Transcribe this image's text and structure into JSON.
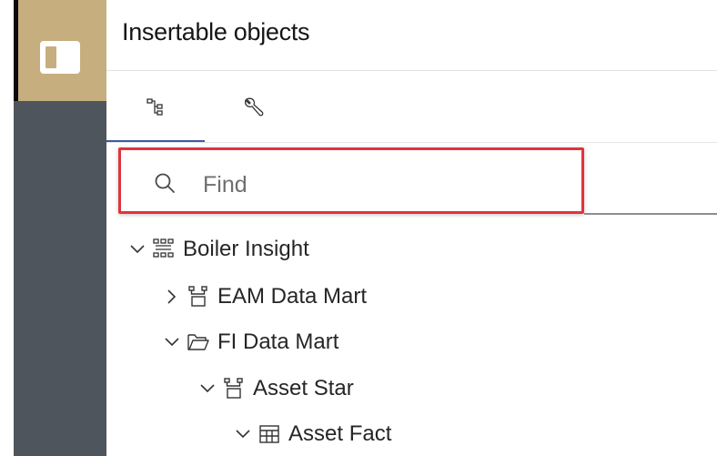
{
  "panel": {
    "title": "Insertable objects",
    "tabs": [
      {
        "name": "sources",
        "icon": "tree-hierarchy-icon",
        "selected": true
      },
      {
        "name": "tools",
        "icon": "wrench-icon",
        "selected": false
      }
    ]
  },
  "search": {
    "placeholder": "Find",
    "value": ""
  },
  "tree": [
    {
      "label": "Boiler Insight",
      "expanded": true,
      "icon": "package-icon"
    },
    {
      "label": "EAM Data Mart",
      "expanded": false,
      "icon": "namespace-icon"
    },
    {
      "label": "FI Data Mart",
      "expanded": true,
      "icon": "folder-icon"
    },
    {
      "label": "Asset Star",
      "expanded": true,
      "icon": "namespace-icon"
    },
    {
      "label": "Asset Fact",
      "expanded": true,
      "icon": "table-icon"
    }
  ],
  "colors": {
    "rail_active": "#c7ae7f",
    "rail_body": "#4f555c",
    "highlight_box": "#e0343c",
    "tab_underline": "#3d5c9a"
  }
}
